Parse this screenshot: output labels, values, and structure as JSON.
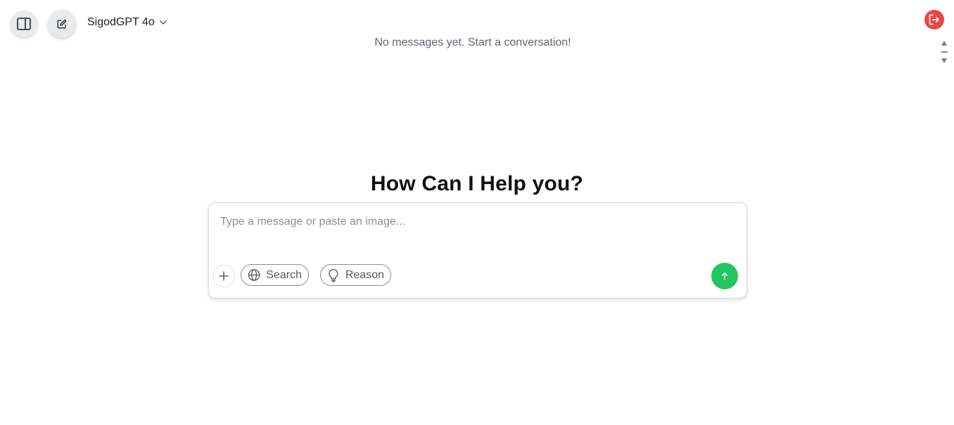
{
  "header": {
    "model_name": "SigodGPT 4o",
    "sidebar_toggle_icon": "sidebar-icon",
    "new_chat_icon": "edit-icon",
    "logout_icon": "logout-icon"
  },
  "conversation": {
    "empty_message": "No messages yet. Start a conversation!"
  },
  "hero": {
    "title": "How Can I Help you?"
  },
  "composer": {
    "placeholder": "Type a message or paste an image...",
    "value": "",
    "search_label": "Search",
    "reason_label": "Reason"
  },
  "colors": {
    "send_button": "#22c55e",
    "logout_button": "#ef4444"
  }
}
